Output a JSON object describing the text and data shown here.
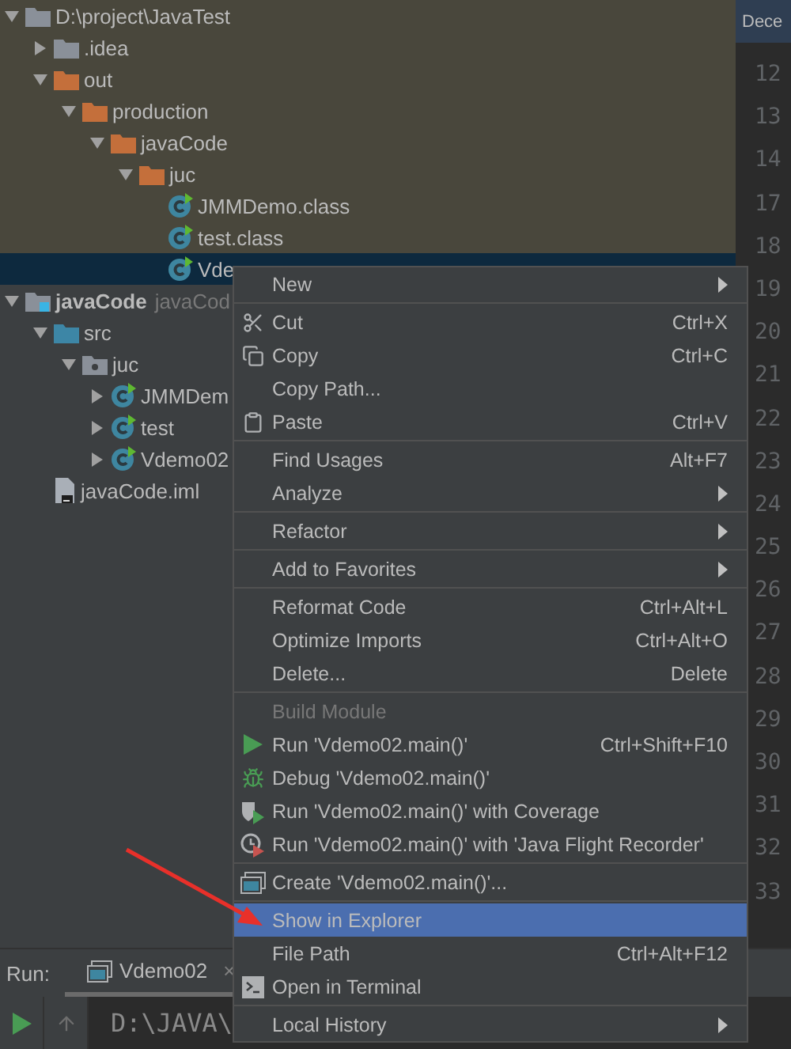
{
  "tree": [
    {
      "label": "D:\\project\\JavaTest",
      "kind": "folder",
      "expanded": true,
      "selected": false,
      "colored": true,
      "children": [
        {
          "label": ".idea",
          "kind": "folder",
          "expanded": false,
          "selected": false
        },
        {
          "label": "out",
          "kind": "excluded-folder",
          "expanded": true,
          "selected": false,
          "children": [
            {
              "label": "production",
              "kind": "excluded-folder",
              "expanded": true,
              "selected": false,
              "children": [
                {
                  "label": "javaCode",
                  "kind": "excluded-folder",
                  "expanded": true,
                  "selected": false,
                  "children": [
                    {
                      "label": "juc",
                      "kind": "excluded-folder",
                      "expanded": true,
                      "selected": false,
                      "children": [
                        {
                          "label": "JMMDemo.class",
                          "kind": "class-file",
                          "selected": false
                        },
                        {
                          "label": "test.class",
                          "kind": "class-file",
                          "selected": false
                        },
                        {
                          "label": "Vde",
                          "kind": "class-file",
                          "selected": true
                        }
                      ]
                    }
                  ]
                }
              ]
            }
          ]
        }
      ]
    },
    {
      "label": "javaCode",
      "secondary": "javaCod",
      "kind": "module",
      "expanded": true,
      "selected": false,
      "colored": false,
      "children": [
        {
          "label": "src",
          "kind": "source-folder",
          "expanded": true,
          "selected": false,
          "children": [
            {
              "label": "juc",
              "kind": "package",
              "expanded": true,
              "selected": false,
              "children": [
                {
                  "label": "JMMDem",
                  "kind": "class",
                  "expanded": false,
                  "selected": false
                },
                {
                  "label": "test",
                  "kind": "class",
                  "expanded": false,
                  "selected": false
                },
                {
                  "label": "Vdemo02",
                  "kind": "class",
                  "expanded": false,
                  "selected": false
                }
              ]
            }
          ]
        },
        {
          "label": "javaCode.iml",
          "kind": "file",
          "selected": false
        }
      ]
    }
  ],
  "editor": {
    "tab": "Dece",
    "line_numbers": [
      "12",
      "13",
      "14",
      "17",
      "18",
      "19",
      "20",
      "21",
      "22",
      "23",
      "24",
      "25",
      "26",
      "27",
      "28",
      "29",
      "30",
      "31",
      "32",
      "33"
    ]
  },
  "context_menu": {
    "groups": [
      [
        {
          "label": "New",
          "kind": "submenu",
          "disabled": false,
          "selected": false
        }
      ],
      [
        {
          "label": "Cut",
          "kind": "cut",
          "shortcut": "Ctrl+X",
          "disabled": false,
          "selected": false
        },
        {
          "label": "Copy",
          "kind": "copy",
          "shortcut": "Ctrl+C",
          "disabled": false,
          "selected": false
        },
        {
          "label": "Copy Path...",
          "kind": "plain",
          "disabled": false,
          "selected": false
        },
        {
          "label": "Paste",
          "kind": "paste",
          "shortcut": "Ctrl+V",
          "disabled": false,
          "selected": false
        }
      ],
      [
        {
          "label": "Find Usages",
          "kind": "plain",
          "shortcut": "Alt+F7",
          "disabled": false,
          "selected": false
        },
        {
          "label": "Analyze",
          "kind": "submenu",
          "disabled": false,
          "selected": false
        }
      ],
      [
        {
          "label": "Refactor",
          "kind": "submenu",
          "disabled": false,
          "selected": false
        }
      ],
      [
        {
          "label": "Add to Favorites",
          "kind": "submenu",
          "disabled": false,
          "selected": false
        }
      ],
      [
        {
          "label": "Reformat Code",
          "kind": "plain",
          "shortcut": "Ctrl+Alt+L",
          "disabled": false,
          "selected": false
        },
        {
          "label": "Optimize Imports",
          "kind": "plain",
          "shortcut": "Ctrl+Alt+O",
          "disabled": false,
          "selected": false
        },
        {
          "label": "Delete...",
          "kind": "plain",
          "shortcut": "Delete",
          "disabled": false,
          "selected": false
        }
      ],
      [
        {
          "label": "Build Module",
          "kind": "plain",
          "disabled": true,
          "selected": false
        },
        {
          "label": "Run 'Vdemo02.main()'",
          "kind": "run",
          "shortcut": "Ctrl+Shift+F10",
          "disabled": false,
          "selected": false
        },
        {
          "label": "Debug 'Vdemo02.main()'",
          "kind": "debug",
          "disabled": false,
          "selected": false
        },
        {
          "label": "Run 'Vdemo02.main()' with Coverage",
          "kind": "coverage",
          "disabled": false,
          "selected": false
        },
        {
          "label": "Run 'Vdemo02.main()' with 'Java Flight Recorder'",
          "kind": "profile",
          "disabled": false,
          "selected": false
        }
      ],
      [
        {
          "label": "Create 'Vdemo02.main()'...",
          "kind": "create",
          "disabled": false,
          "selected": false
        }
      ],
      [
        {
          "label": "Show in Explorer",
          "kind": "plain",
          "disabled": false,
          "selected": true
        },
        {
          "label": "File Path",
          "kind": "plain",
          "shortcut": "Ctrl+Alt+F12",
          "disabled": false,
          "selected": false
        },
        {
          "label": "Open in Terminal",
          "kind": "terminal",
          "disabled": false,
          "selected": false
        }
      ],
      [
        {
          "label": "Local History",
          "kind": "submenu",
          "disabled": false,
          "selected": false
        }
      ]
    ]
  },
  "run_panel": {
    "label": "Run:",
    "tab": "Vdemo02",
    "close": "×",
    "console": "D:\\JAVA\\"
  }
}
